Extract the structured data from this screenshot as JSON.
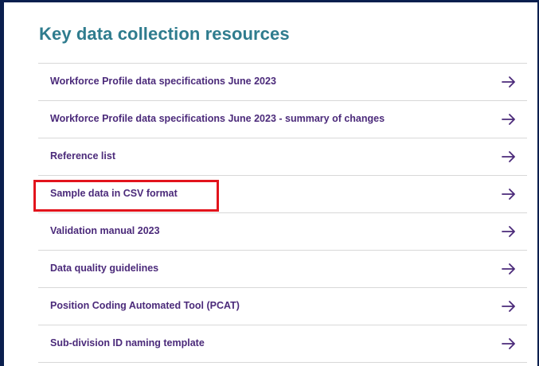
{
  "section": {
    "title": "Key data collection resources"
  },
  "resources": [
    {
      "label": "Workforce Profile data specifications June 2023",
      "icon": "arrow-right-icon"
    },
    {
      "label": "Workforce Profile data specifications June 2023 - summary of changes",
      "icon": "arrow-right-icon"
    },
    {
      "label": "Reference list",
      "icon": "arrow-right-icon"
    },
    {
      "label": "Sample data in CSV format",
      "icon": "arrow-right-icon",
      "highlighted": true
    },
    {
      "label": "Validation manual 2023",
      "icon": "arrow-right-icon"
    },
    {
      "label": "Data quality guidelines",
      "icon": "arrow-right-icon"
    },
    {
      "label": "Position Coding Automated Tool (PCAT)",
      "icon": "arrow-right-icon"
    },
    {
      "label": "Sub-division ID naming template",
      "icon": "arrow-right-icon"
    }
  ],
  "colors": {
    "frame_border": "#0a1f4e",
    "title": "#2f7c8e",
    "link": "#4b2a7a",
    "divider": "#d8d8d8",
    "highlight": "#e2141c"
  }
}
